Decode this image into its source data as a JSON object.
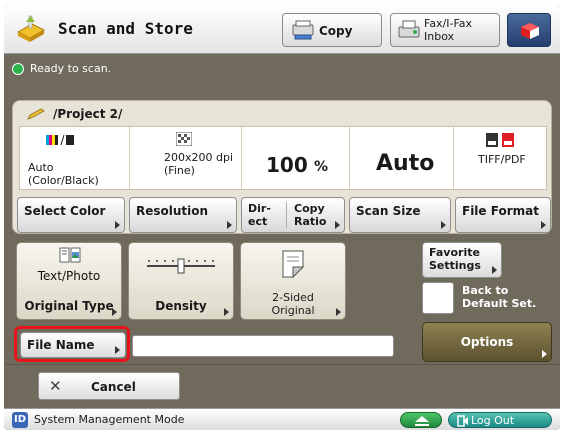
{
  "header": {
    "title": "Scan and Store",
    "copy_label": "Copy",
    "fax_label": "Fax/I-Fax Inbox",
    "app_icon": "scan-store-icon",
    "cube_icon": "cube-icon"
  },
  "status": {
    "text": "Ready to scan.",
    "color": "#2bb24a"
  },
  "project": {
    "path": "/Project 2/"
  },
  "settings": {
    "color_value": "Auto\n(Color/Black)",
    "resolution_value": "200x200 dpi\n(Fine)",
    "ratio_value": "100",
    "ratio_unit": "%",
    "scan_size_value": "Auto",
    "file_format_value": "TIFF/PDF"
  },
  "tabs": {
    "select_color": "Select Color",
    "resolution": "Resolution",
    "direct": "Dir-\nect",
    "copy_ratio": "Copy\nRatio",
    "scan_size": "Scan Size",
    "file_format": "File Format"
  },
  "controls": {
    "original_type_value": "Text/Photo",
    "original_type_label": "Original Type",
    "density_label": "Density",
    "two_sided_label": "2-Sided\nOriginal",
    "favorite_label": "Favorite\nSettings",
    "back_default_label": "Back to\nDefault Set.",
    "file_name_label": "File Name",
    "file_name_value": "",
    "options_label": "Options",
    "cancel_label": "Cancel"
  },
  "footer": {
    "system_mode_label": "System Management Mode",
    "system_mode_badge": "ID",
    "logout_label": "Log Out"
  },
  "colors": {
    "background": "#6f6a5c",
    "panel": "#e7e3d6",
    "highlight": "#e8141b",
    "options_button": "#7a6d40",
    "logout_button": "#1c8a86"
  }
}
